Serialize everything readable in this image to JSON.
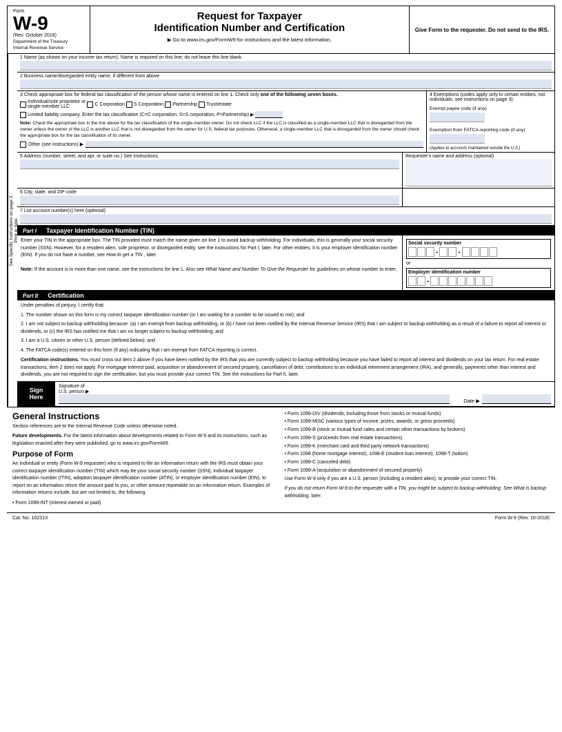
{
  "header": {
    "form_label": "Form",
    "form_number": "W-9",
    "rev_date": "(Rev. October 2018)",
    "dept": "Department of the Treasury",
    "irs": "Internal Revenue Service",
    "main_title": "Request for Taxpayer",
    "sub_title": "Identification Number and Certification",
    "url_line": "▶ Go to www.irs.gov/FormW9 for instructions and the latest information.",
    "give_form": "Give Form to the requester. Do not send to the IRS."
  },
  "fields": {
    "line1_label": "1  Name (as shown on your income tax return). Name is required on this line; do not leave this line blank.",
    "line2_label": "2  Business name/disregarded entity name, if different from above",
    "line3_label": "3  Check appropriate box for federal tax classification of the person whose name is entered on line 1. Check only",
    "line3_label2": "one of the following seven boxes.",
    "classifications": [
      {
        "id": "indiv",
        "label": "Individual/sole proprietor or single-member LLC"
      },
      {
        "id": "ccorp",
        "label": "C Corporation"
      },
      {
        "id": "scorp",
        "label": "S Corporation"
      },
      {
        "id": "partner",
        "label": "Partnership"
      },
      {
        "id": "trust",
        "label": "Trust/estate"
      }
    ],
    "llc_label": "Limited liability company. Enter the tax classification (C=C corporation, S=S corporation, P=Partnership) ▶",
    "note_label": "Note:",
    "note_text": "Check the appropriate box in the line above for the tax classification of the single-member owner.  Do not check LLC if the LLC is classified as a single-member LLC that is disregarded from the owner unless the owner of the LLC is another LLC that is not disregarded from the owner for U.S. federal tax purposes. Otherwise, a single-member LLC that is disregarded from the owner should check the appropriate box for the tax classification of its owner.",
    "other_label": "Other (see instructions) ▶",
    "exempt_label": "4  Exemptions (codes apply only to certain entities, not individuals; see instructions on page 3):",
    "exempt_payee_label": "Exempt payee code (if any)",
    "fatca_label": "Exemption from FATCA reporting code (if any)",
    "fatca_note": "(Applies to accounts maintained outside the U.S.)",
    "line5_label": "5  Address (number, street, and apt. or suite no.) See instructions.",
    "line5_right": "Requester's name and address (optional)",
    "line6_label": "6  City, state, and ZIP code",
    "line7_label": "7  List account number(s) here (optional)",
    "sidebar_top": "Print or type.",
    "sidebar_bottom": "See Specific Instructions on page 3."
  },
  "part1": {
    "num": "Part I",
    "title": "Taxpayer Identification Number (TIN)",
    "body": "Enter your TIN in the appropriate box. The TIN provided must match the name given on line 1 to avoid backup withholding. For individuals, this is generally your social security number (SSN). However, for a resident alien, sole proprietor, or disregarded entity, see the instructions for Part I, later. For other entities, it is your employer identification number (EIN). If you do not have a number, see",
    "body_italic": "How to get a TIN",
    "body_end": ", later.",
    "note_label": "Note:",
    "note_text": "If the account is in more than one name, see the instructions for line 1. Also see",
    "note_italic": "What Name and Number To Give the Requester",
    "note_end": "for guidelines on whose number to enter.",
    "ssn_label": "Social security number",
    "or_text": "or",
    "ein_label": "Employer identification number"
  },
  "part2": {
    "num": "Part II",
    "title": "Certification",
    "under_text": "Under penalties of perjury, I certify that:",
    "items": [
      "1. The number shown on this form is my correct taxpayer identification number (or I am waiting for a number to be issued to me); and",
      "2. I am not subject to backup withholding because: (a) I am exempt from backup withholding, or (b) I have not been notified by the Internal Revenue Service (IRS) that I am subject to backup withholding as a result of a failure to report all interest or dividends, or (c) the IRS has notified me that I am no longer subject to backup withholding; and",
      "3. I am a U.S. citizen or other U.S. person (defined below); and",
      "4. The FATCA code(s) entered on this form (if any) indicating that I am exempt from FATCA reporting is correct."
    ],
    "cert_instructions_label": "Certification instructions.",
    "cert_instructions": "You must cross out item 2 above if you have been notified by the IRS that you are currently subject to backup withholding because you have failed to report all interest and dividends on your tax return. For real estate transactions, item 2 does not apply. For mortgage interest paid, acquisition or abandonment of secured property, cancellation of debt, contributions to an individual retirement arrangement (IRA), and generally, payments other than interest and dividends, you are not required to sign the certification, but you must provide your correct TIN. See the instructions for Part II, later."
  },
  "sign": {
    "label_line1": "Sign",
    "label_line2": "Here",
    "sig_label": "Signature of",
    "sig_label2": "U.S. person ▶",
    "date_label": "Date ▶"
  },
  "general": {
    "title": "General Instructions",
    "intro": "Section references are to the Internal Revenue Code unless otherwise noted.",
    "future_label": "Future developments.",
    "future_text": "For the latest information about developments related to Form W-9 and its instructions, such as legislation enacted after they were published, go to",
    "future_url": "www.irs.gov/FormW9",
    "future_end": ".",
    "purpose_title": "Purpose of Form",
    "purpose_text": "An individual or entity (Form W-9 requester) who is required to file an information return with the IRS must obtain your correct taxpayer identification number (TIN) which may be your social security number (SSN), individual taxpayer identification number (ITIN), adoption taxpayer identification number (ATIN), or employer identification number (EIN), to report on an information return the amount paid to you, or other amount reportable on an information return. Examples of information returns include, but are not limited to, the following.",
    "bullet_items_left": [
      "• Form 1099-INT (interest earned or paid)"
    ],
    "bullet_items_right": [
      "• Form 1099-DIV (dividends, including those from stocks or mutual funds)",
      "• Form 1099-MISC (various types of income, prizes, awards, or gross proceeds)",
      "• Form 1099-B (stock or mutual fund sales and certain other transactions by brokers)",
      "• Form 1099-S (proceeds from real estate transactions)",
      "• Form 1099-K (merchant card and third party network transactions)",
      "• Form 1098 (home mortgage interest), 1098-E (student loan interest), 1098-T (tuition)",
      "• Form 1099-C (canceled debt)",
      "• Form 1099-A (acquisition or abandonment of secured property)",
      "Use Form W-9 only if you are a U.S. person (including a resident alien), to provide your correct TIN.",
      "If you do not return Form W-9 to the requester with a TIN, you might be subject to backup withholding. See What is backup withholding, later."
    ]
  },
  "footer": {
    "cat_num": "Cat. No. 10231X",
    "form_label": "Form W-9 (Rev. 10-2018)"
  }
}
